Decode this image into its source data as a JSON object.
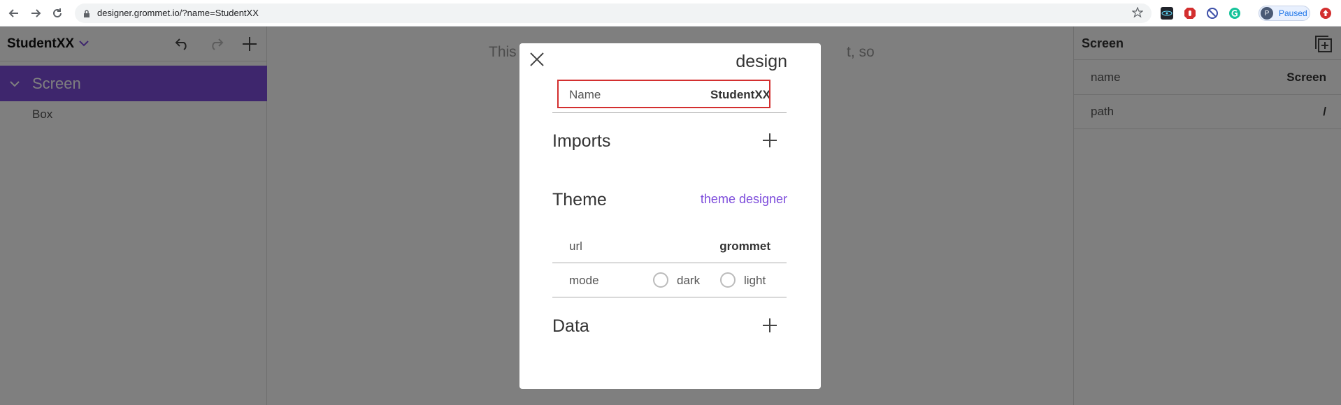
{
  "browser": {
    "url": "designer.grommet.io/?name=StudentXX",
    "profile_initial": "P",
    "profile_label": "Paused",
    "icons": [
      "back-icon",
      "forward-icon",
      "reload-icon",
      "lock-icon",
      "star-icon",
      "react-devtools-icon",
      "adblock-icon",
      "block-icon",
      "grammarly-icon",
      "update-icon"
    ]
  },
  "left_panel": {
    "project_name": "StudentXX",
    "tree": {
      "selected": "Screen",
      "child": "Box"
    }
  },
  "canvas": {
    "hint_left": "This",
    "hint_right": "t, so"
  },
  "right_panel": {
    "title": "Screen",
    "properties": [
      {
        "key": "name",
        "value": "Screen"
      },
      {
        "key": "path",
        "value": "/"
      }
    ]
  },
  "dialog": {
    "title": "design",
    "name_label": "Name",
    "name_value": "StudentXX",
    "imports_title": "Imports",
    "theme_title": "Theme",
    "theme_link": "theme designer",
    "url_label": "url",
    "url_value": "grommet",
    "mode_label": "mode",
    "mode_options": [
      "dark",
      "light"
    ],
    "data_title": "Data"
  },
  "colors": {
    "accent": "#7d4cdb",
    "highlight": "#d32f2f"
  }
}
